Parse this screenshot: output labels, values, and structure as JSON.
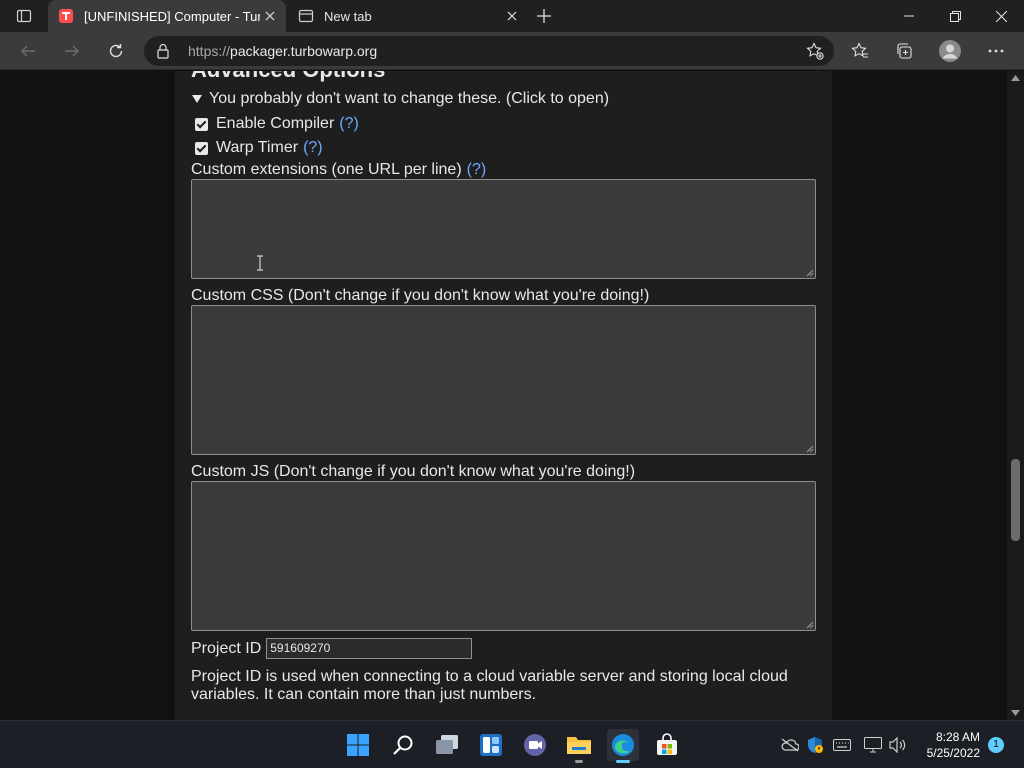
{
  "browser": {
    "tabs": [
      {
        "title": "[UNFINISHED] Computer - Turbo",
        "active": true
      },
      {
        "title": "New tab",
        "active": false
      }
    ],
    "url_host": "packager.turbowarp.org",
    "url_scheme": "https://"
  },
  "page": {
    "section_title": "Advanced Options",
    "summary": "You probably don't want to change these. (Click to open)",
    "enable_compiler_label": "Enable Compiler",
    "enable_compiler_checked": true,
    "warp_timer_label": "Warp Timer",
    "warp_timer_checked": true,
    "help_link": "(?)",
    "custom_extensions_label": "Custom extensions (one URL per line)",
    "custom_extensions_value": "",
    "custom_css_label": "Custom CSS (Don't change if you don't know what you're doing!)",
    "custom_css_value": "",
    "custom_js_label": "Custom JS (Don't change if you don't know what you're doing!)",
    "custom_js_value": "",
    "project_id_label": "Project ID",
    "project_id_value": "591609270",
    "project_id_note": "Project ID is used when connecting to a cloud variable server and storing local cloud variables. It can contain more than just numbers."
  },
  "scroll": {
    "position_fraction": 0.86
  },
  "taskbar": {
    "time": "8:28 AM",
    "date": "5/25/2022",
    "notification_count": "1",
    "apps": [
      "start-icon",
      "search-icon",
      "task-view-icon",
      "widgets-icon",
      "teams-chat-icon",
      "file-explorer-icon",
      "edge-icon",
      "store-icon"
    ]
  },
  "colors": {
    "page_bg": "#111111",
    "panel_bg": "#1e1e1e",
    "field_bg": "#3b3b3b",
    "link": "#6ea8ff",
    "accent": "#60cdff"
  }
}
